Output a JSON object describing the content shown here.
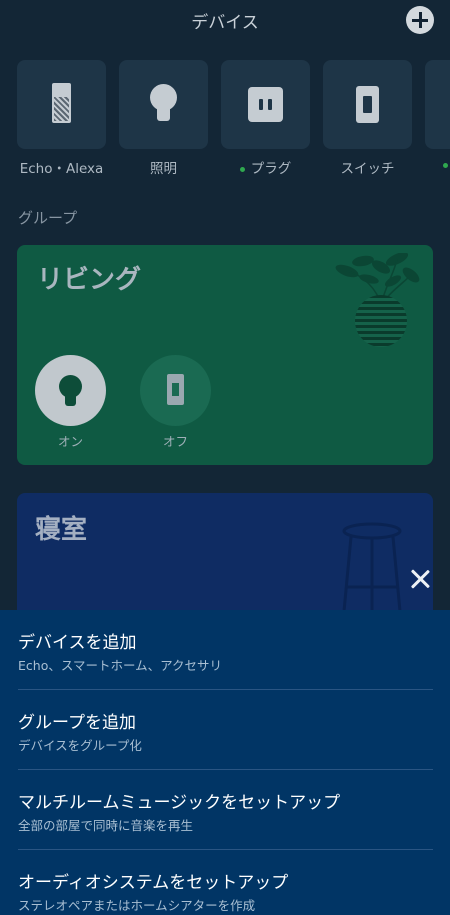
{
  "header": {
    "title": "デバイス"
  },
  "device_types": [
    {
      "label": "Echo・Alexa",
      "icon": "echo-device-icon",
      "status_dot": false
    },
    {
      "label": "照明",
      "icon": "light-bulb-icon",
      "status_dot": false
    },
    {
      "label": "プラグ",
      "icon": "plug-icon",
      "status_dot": true
    },
    {
      "label": "スイッチ",
      "icon": "switch-icon",
      "status_dot": false
    }
  ],
  "groups_section": {
    "label": "グループ"
  },
  "groups": [
    {
      "name": "リビング",
      "controls": [
        {
          "label": "オン",
          "icon": "light-bulb-icon"
        },
        {
          "label": "オフ",
          "icon": "switch-icon"
        }
      ]
    },
    {
      "name": "寝室"
    }
  ],
  "menu": {
    "items": [
      {
        "title": "デバイスを追加",
        "subtitle": "Echo、スマートホーム、アクセサリ"
      },
      {
        "title": "グループを追加",
        "subtitle": "デバイスをグループ化"
      },
      {
        "title": "マルチルームミュージックをセットアップ",
        "subtitle": "全部の部屋で同時に音楽を再生"
      },
      {
        "title": "オーディオシステムをセットアップ",
        "subtitle": "ステレオペアまたはホームシアターを作成"
      }
    ]
  },
  "colors": {
    "background": "#132636",
    "tile": "#1e3547",
    "group_living": "#0f5a43",
    "group_bedroom": "#0f2c63",
    "sheet": "#013565",
    "status_dot": "#2fa84f"
  }
}
